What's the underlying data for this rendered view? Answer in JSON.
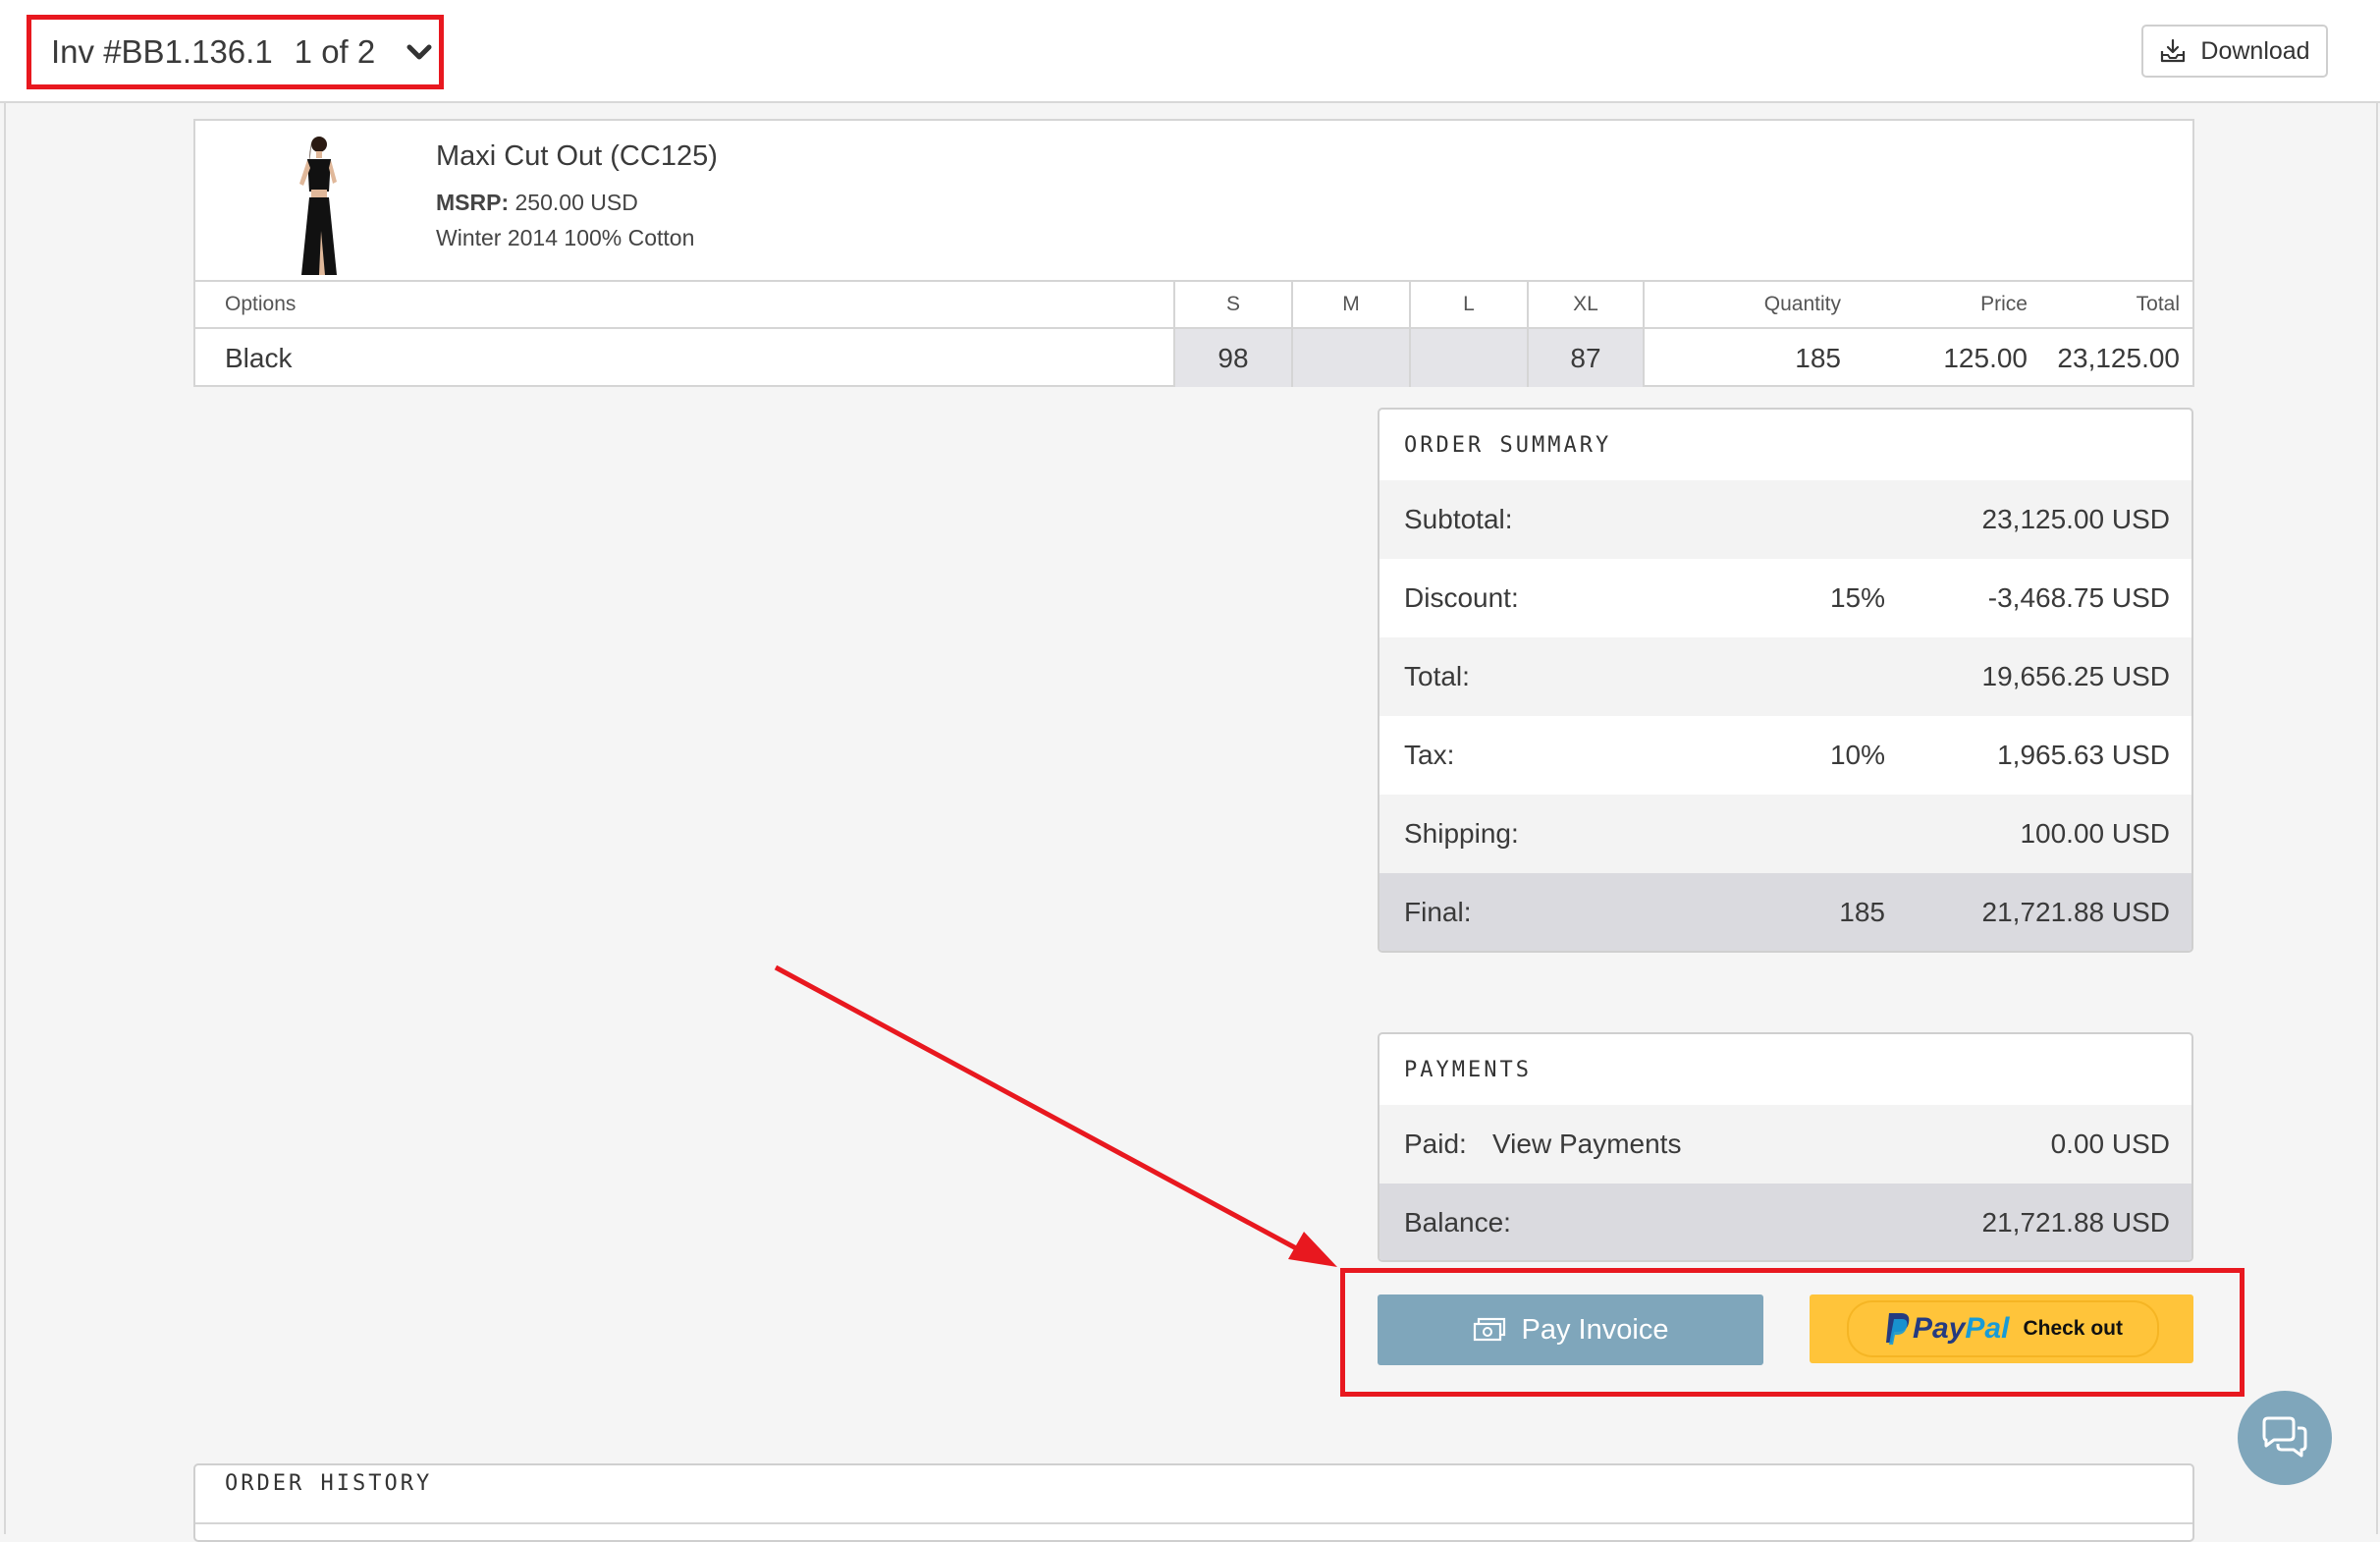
{
  "header": {
    "invoice_number": "Inv #BB1.136.1",
    "page_indicator": "1 of 2",
    "chevron_icon": "chevron-down-icon",
    "download_label": "Download",
    "download_icon": "download-icon"
  },
  "product": {
    "name": "Maxi Cut Out (CC125)",
    "msrp_label": "MSRP:",
    "msrp_value": "250.00 USD",
    "season": "Winter 2014 100% Cotton",
    "table": {
      "headers": {
        "options": "Options",
        "s": "S",
        "m": "M",
        "l": "L",
        "xl": "XL",
        "quantity": "Quantity",
        "price": "Price",
        "total": "Total"
      },
      "row": {
        "option": "Black",
        "s": "98",
        "m": "",
        "l": "",
        "xl": "87",
        "quantity": "185",
        "price": "125.00",
        "total": "23,125.00"
      }
    }
  },
  "order_summary": {
    "title": "ORDER SUMMARY",
    "rows": [
      {
        "label": "Subtotal:",
        "mid": "",
        "value": "23,125.00 USD"
      },
      {
        "label": "Discount:",
        "mid": "15%",
        "value": "-3,468.75 USD"
      },
      {
        "label": "Total:",
        "mid": "",
        "value": "19,656.25 USD"
      },
      {
        "label": "Tax:",
        "mid": "10%",
        "value": "1,965.63 USD"
      },
      {
        "label": "Shipping:",
        "mid": "",
        "value": "100.00 USD"
      },
      {
        "label": "Final:",
        "mid": "185",
        "value": "21,721.88 USD"
      }
    ]
  },
  "payments": {
    "title": "PAYMENTS",
    "paid_label": "Paid:",
    "view_payments": "View Payments",
    "paid_value": "0.00 USD",
    "balance_label": "Balance:",
    "balance_value": "21,721.88 USD"
  },
  "actions": {
    "pay_invoice": "Pay Invoice",
    "pay_icon": "money-icon",
    "paypal_word_1": "Pay",
    "paypal_word_2": "Pal",
    "paypal_checkout": "Check out"
  },
  "chat": {
    "icon": "chat-icon"
  },
  "order_history": {
    "title": "ORDER HISTORY"
  },
  "colors": {
    "annotation_red": "#e8181f",
    "pay_button": "#7fa6bb",
    "paypal_yellow": "#ffc43a",
    "paypal_dark_blue": "#253b80",
    "paypal_light_blue": "#179bd7"
  }
}
